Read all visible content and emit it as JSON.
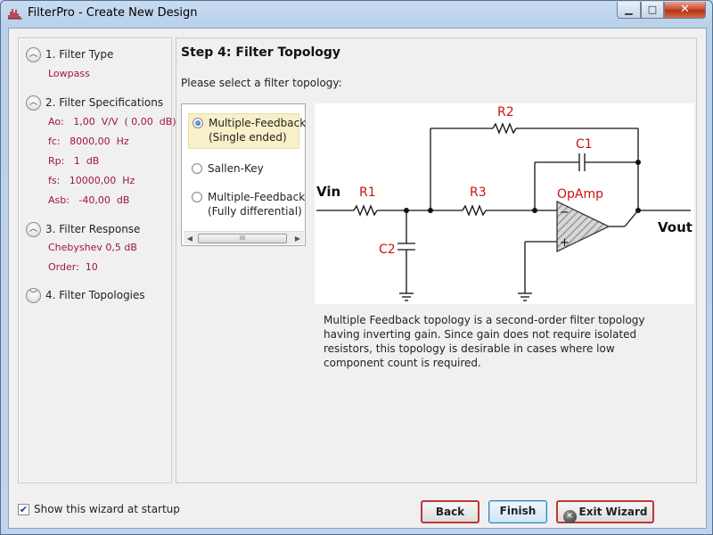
{
  "window": {
    "title": "FilterPro - Create New Design",
    "controls": {
      "minimize": "▁",
      "maximize": "□",
      "close": "✕"
    }
  },
  "sidebar": {
    "steps": [
      {
        "toggle": "︿",
        "title": "1. Filter Type",
        "details": [
          "Lowpass"
        ]
      },
      {
        "toggle": "︿",
        "title": "2. Filter Specifications",
        "details": [
          "Ao:   1,00  V/V  ( 0,00  dB)",
          "fc:   8000,00  Hz",
          "Rp:   1  dB",
          "fs:   10000,00  Hz",
          "Asb:   -40,00  dB"
        ]
      },
      {
        "toggle": "︿",
        "title": "3. Filter Response",
        "details": [
          "Chebyshev 0,5 dB",
          "Order:  10"
        ]
      },
      {
        "toggle": "﹀",
        "title": "4. Filter Topologies",
        "details": []
      }
    ]
  },
  "main": {
    "heading": "Step 4: Filter Topology",
    "prompt": "Please select a filter topology:",
    "topologies": [
      {
        "label": "Multiple-Feedback\n(Single ended)",
        "selected": true
      },
      {
        "label": "Sallen-Key",
        "selected": false
      },
      {
        "label": "Multiple-Feedback\n(Fully differential)",
        "selected": false
      }
    ],
    "scroll": {
      "left": "◀",
      "grip": "III",
      "right": "▶"
    },
    "schematic": {
      "labels": {
        "vin": "Vin",
        "vout": "Vout",
        "r1": "R1",
        "r2": "R2",
        "r3": "R3",
        "c1": "C1",
        "c2": "C2",
        "opamp": "OpAmp",
        "minus": "−",
        "plus": "+"
      },
      "label_color": "#cc1111"
    },
    "description": "Multiple Feedback topology is a second-order filter topology having inverting gain. Since gain does not require isolated resistors, this topology is desirable in cases where low component count is required."
  },
  "footer": {
    "show_wizard_checked": true,
    "check_mark": "✔",
    "show_wizard_label": "Show this wizard at startup",
    "back_label": "Back",
    "finish_label": "Finish",
    "exit_label": "Exit Wizard",
    "exit_glyph": "✕"
  }
}
